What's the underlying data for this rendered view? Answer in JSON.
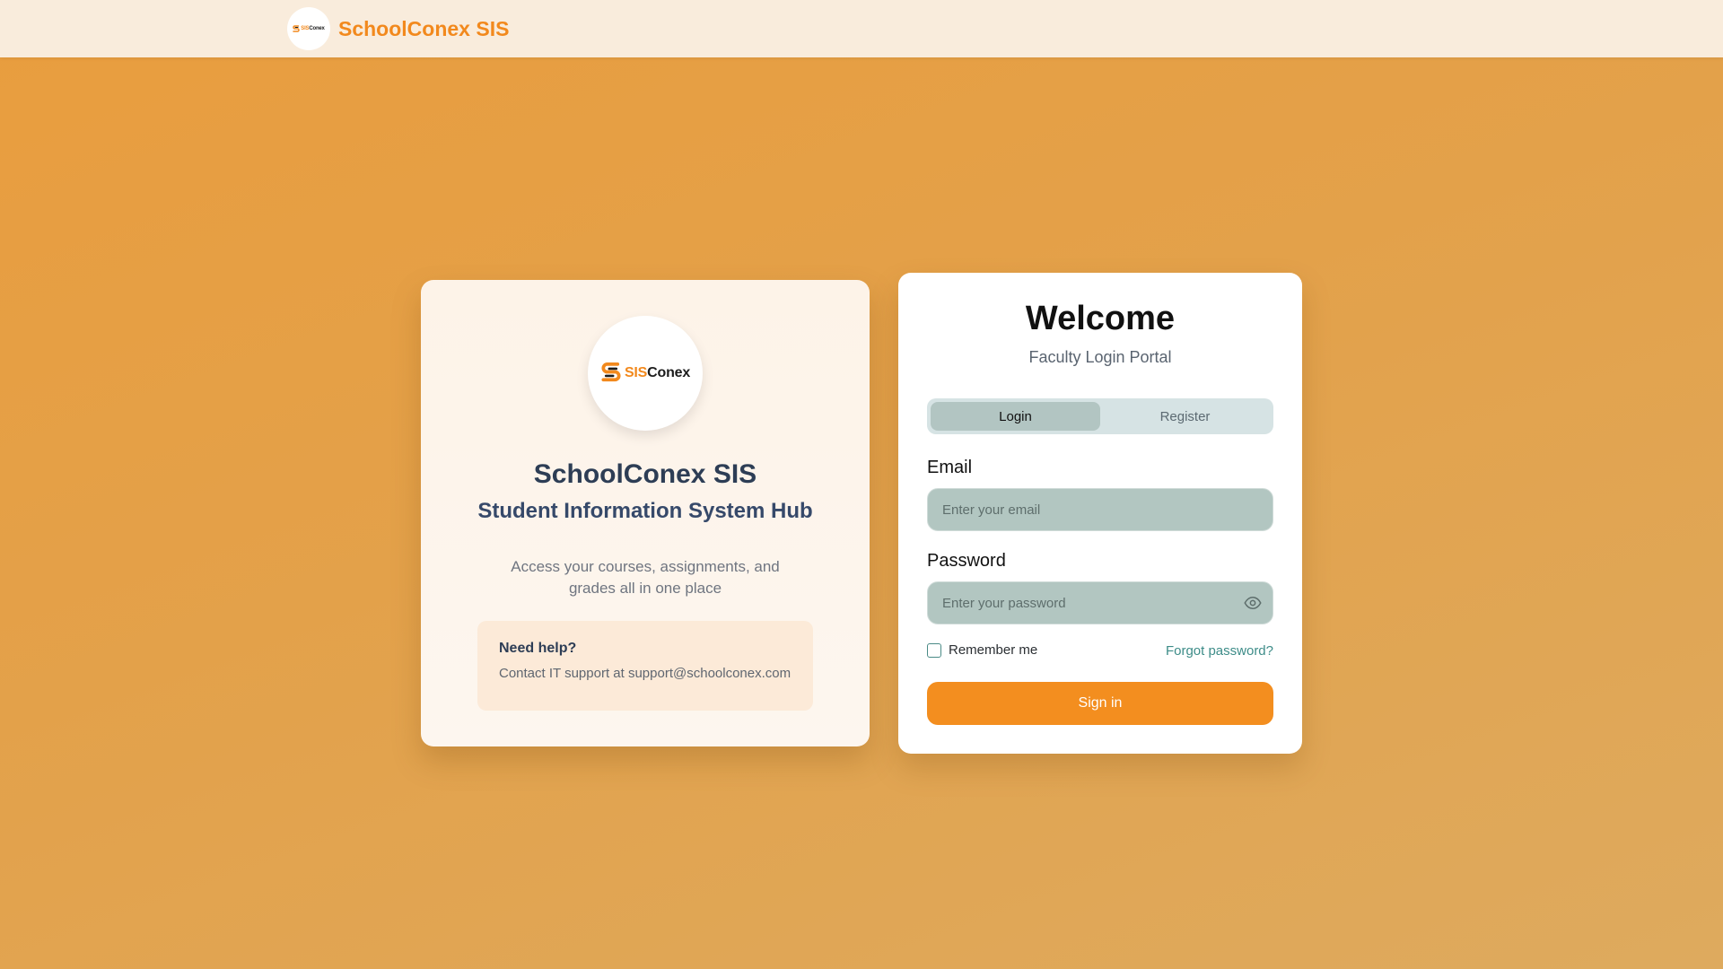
{
  "header": {
    "brand_title": "SchoolConex SIS",
    "logo_sis": "SIS",
    "logo_conex": "Conex"
  },
  "info_card": {
    "logo_sis": "SIS",
    "logo_conex": "Conex",
    "title": "SchoolConex SIS",
    "subtitle": "Student Information System Hub",
    "description": "Access your courses, assignments, and grades all in one place",
    "help": {
      "title": "Need help?",
      "text": "Contact IT support at support@schoolconex.com"
    }
  },
  "login_card": {
    "title": "Welcome",
    "subtitle": "Faculty Login Portal",
    "tabs": [
      {
        "label": "Login",
        "active": true
      },
      {
        "label": "Register",
        "active": false
      }
    ],
    "email": {
      "label": "Email",
      "placeholder": "Enter your email",
      "value": ""
    },
    "password": {
      "label": "Password",
      "placeholder": "Enter your password",
      "value": ""
    },
    "remember_label": "Remember me",
    "remember_checked": false,
    "forgot_label": "Forgot password?",
    "submit_label": "Sign in"
  },
  "icons": [
    "logo-icon",
    "eye-icon",
    "checkbox-icon"
  ],
  "colors": {
    "accent": "#f38e1f",
    "brand_orange": "#f2891d",
    "background_orange": "#e69f45",
    "link_teal": "#3d8c88",
    "input_fill": "#b2c6c1",
    "heading_navy": "#2d3d55"
  }
}
